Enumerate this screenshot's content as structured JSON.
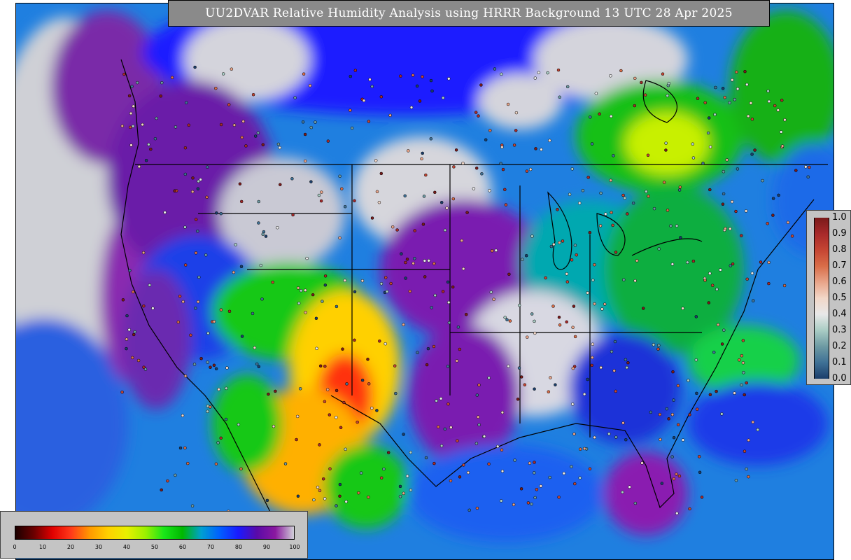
{
  "title": "UU2DVAR Relative Humidity Analysis using HRRR Background 13 UTC 28 Apr 2025",
  "qc_legend": {
    "labels": [
      "1.0",
      "0.9",
      "0.8",
      "0.7",
      "0.6",
      "0.5",
      "0.4",
      "0.3",
      "0.2",
      "0.1",
      "0.0"
    ],
    "colors": [
      "#7a1a1a",
      "#a8292a",
      "#c54533",
      "#d96d48",
      "#e8a489",
      "#f2d7c8",
      "#e8e8e8",
      "#a9ccc4",
      "#6d9aa3",
      "#3f7196",
      "#1b3e6b"
    ]
  },
  "rh_legend": {
    "ticks": [
      "0",
      "10",
      "20",
      "30",
      "40",
      "50",
      "60",
      "70",
      "80",
      "90",
      "100"
    ],
    "colors": [
      "#1a0000",
      "#6b0000",
      "#e00000",
      "#ff3a1a",
      "#ff9900",
      "#ffd000",
      "#e8f000",
      "#9cf000",
      "#19e619",
      "#00b800",
      "#00a0d0",
      "#0060ff",
      "#1a1aff",
      "#5a0aa8",
      "#8a18a0",
      "#d0d0d8"
    ]
  },
  "colors": {
    "frame": "#000000",
    "panel": "#c4c4c4",
    "title_bg": "#8a8a8a",
    "title_fg": "#ffffff"
  }
}
